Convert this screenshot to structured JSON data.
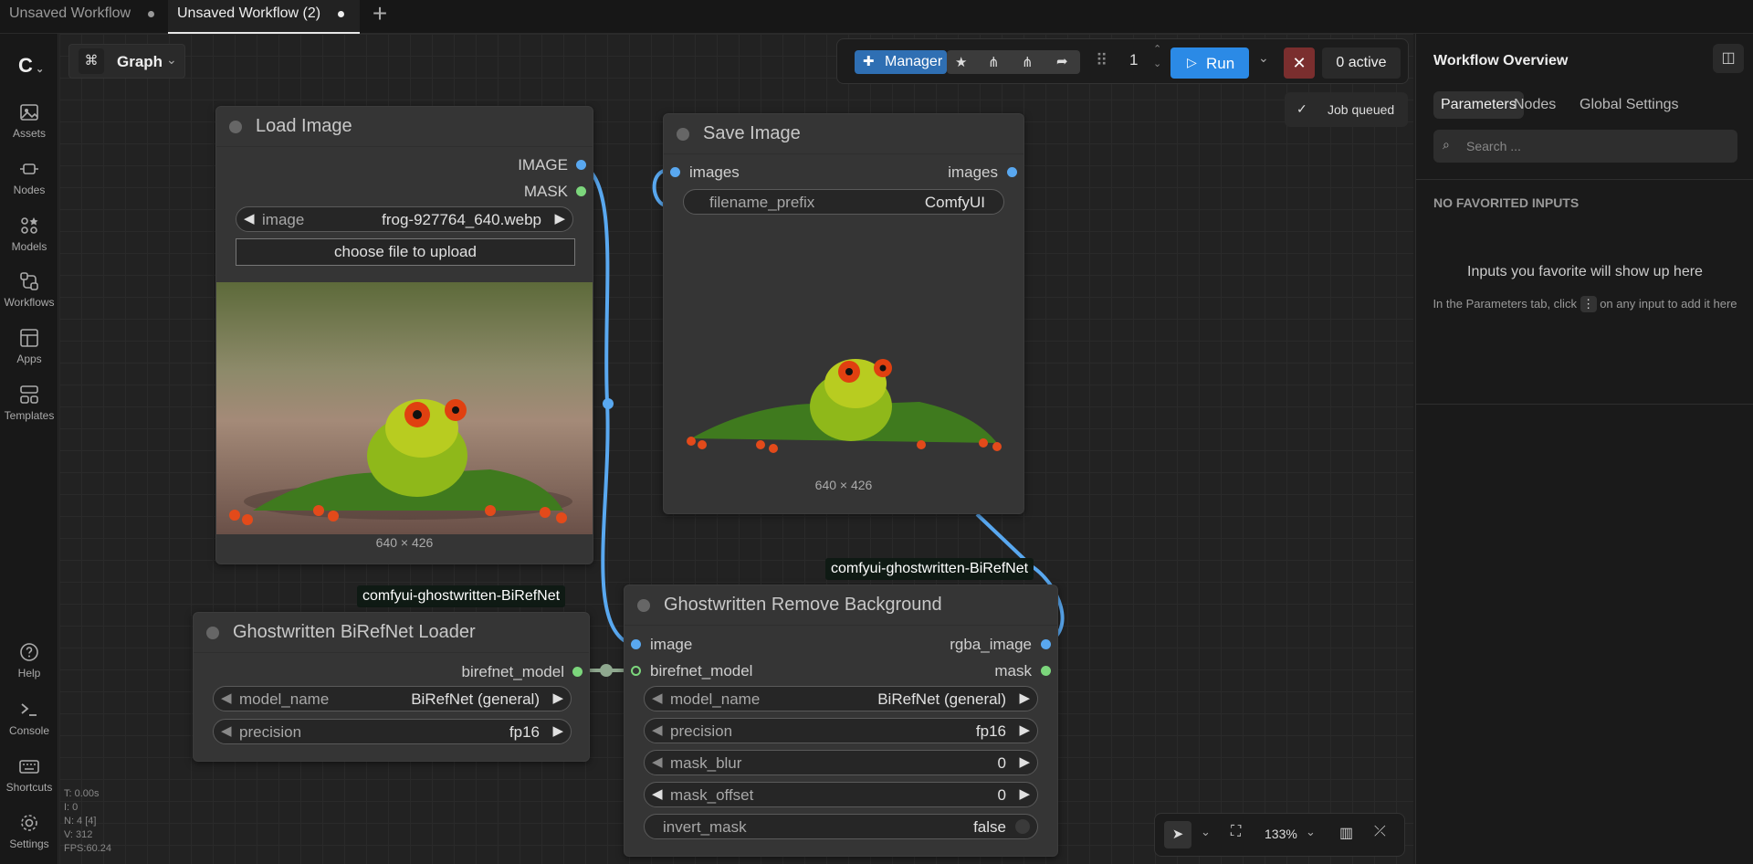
{
  "tabs": [
    {
      "label": "Unsaved Workflow"
    },
    {
      "label": "Unsaved Workflow (2)"
    }
  ],
  "sidebar": {
    "items": [
      {
        "label": "Assets"
      },
      {
        "label": "Nodes"
      },
      {
        "label": "Models"
      },
      {
        "label": "Workflows"
      },
      {
        "label": "Apps"
      },
      {
        "label": "Templates"
      },
      {
        "label": "Help"
      },
      {
        "label": "Console"
      },
      {
        "label": "Shortcuts"
      },
      {
        "label": "Settings"
      }
    ]
  },
  "toolbar": {
    "graph_label": "Graph",
    "manager_label": "Manager",
    "queue_count": "1",
    "run_label": "Run",
    "active_label": "0 active",
    "toast": "Job queued"
  },
  "nodes": {
    "load_image": {
      "title": "Load Image",
      "out_image": "IMAGE",
      "out_mask": "MASK",
      "widget_label": "image",
      "widget_value": "frog-927764_640.webp",
      "upload_label": "choose file to upload",
      "size": "640 × 426"
    },
    "save_image": {
      "title": "Save Image",
      "in_images": "images",
      "out_images": "images",
      "widget_label": "filename_prefix",
      "widget_value": "ComfyUI",
      "size": "640 × 426"
    },
    "loader": {
      "title": "Ghostwritten BiRefNet Loader",
      "badge": "comfyui-ghostwritten-BiRefNet",
      "out": "birefnet_model",
      "w1_label": "model_name",
      "w1_value": "BiRefNet (general)",
      "w2_label": "precision",
      "w2_value": "fp16"
    },
    "remove_bg": {
      "title": "Ghostwritten Remove Background",
      "badge": "comfyui-ghostwritten-BiRefNet",
      "in_image": "image",
      "in_model": "birefnet_model",
      "out_rgba": "rgba_image",
      "out_mask": "mask",
      "w1_label": "model_name",
      "w1_value": "BiRefNet (general)",
      "w2_label": "precision",
      "w2_value": "fp16",
      "w3_label": "mask_blur",
      "w3_value": "0",
      "w4_label": "mask_offset",
      "w4_value": "0",
      "w5_label": "invert_mask",
      "w5_value": "false"
    }
  },
  "stats": {
    "t": "T: 0.00s",
    "i": "I: 0",
    "n": "N: 4 [4]",
    "v": "V: 312",
    "fps": "FPS:60.24"
  },
  "bottom": {
    "zoom": "133%"
  },
  "panel": {
    "title": "Workflow Overview",
    "tabs": [
      {
        "label": "Parameters"
      },
      {
        "label": "Nodes"
      },
      {
        "label": "Global Settings"
      }
    ],
    "search_placeholder": "Search ...",
    "section": "NO FAVORITED INPUTS",
    "empty_title": "Inputs you favorite will show up here",
    "hint_pre": "In the Parameters tab, click",
    "hint_post": "on any input to add it here"
  },
  "colors": {
    "accent": "#2b8ae6",
    "manager": "#2f6fb3",
    "slot_image": "#59a8f0",
    "slot_model": "#7cd67c",
    "stop": "#7a2e2e"
  }
}
